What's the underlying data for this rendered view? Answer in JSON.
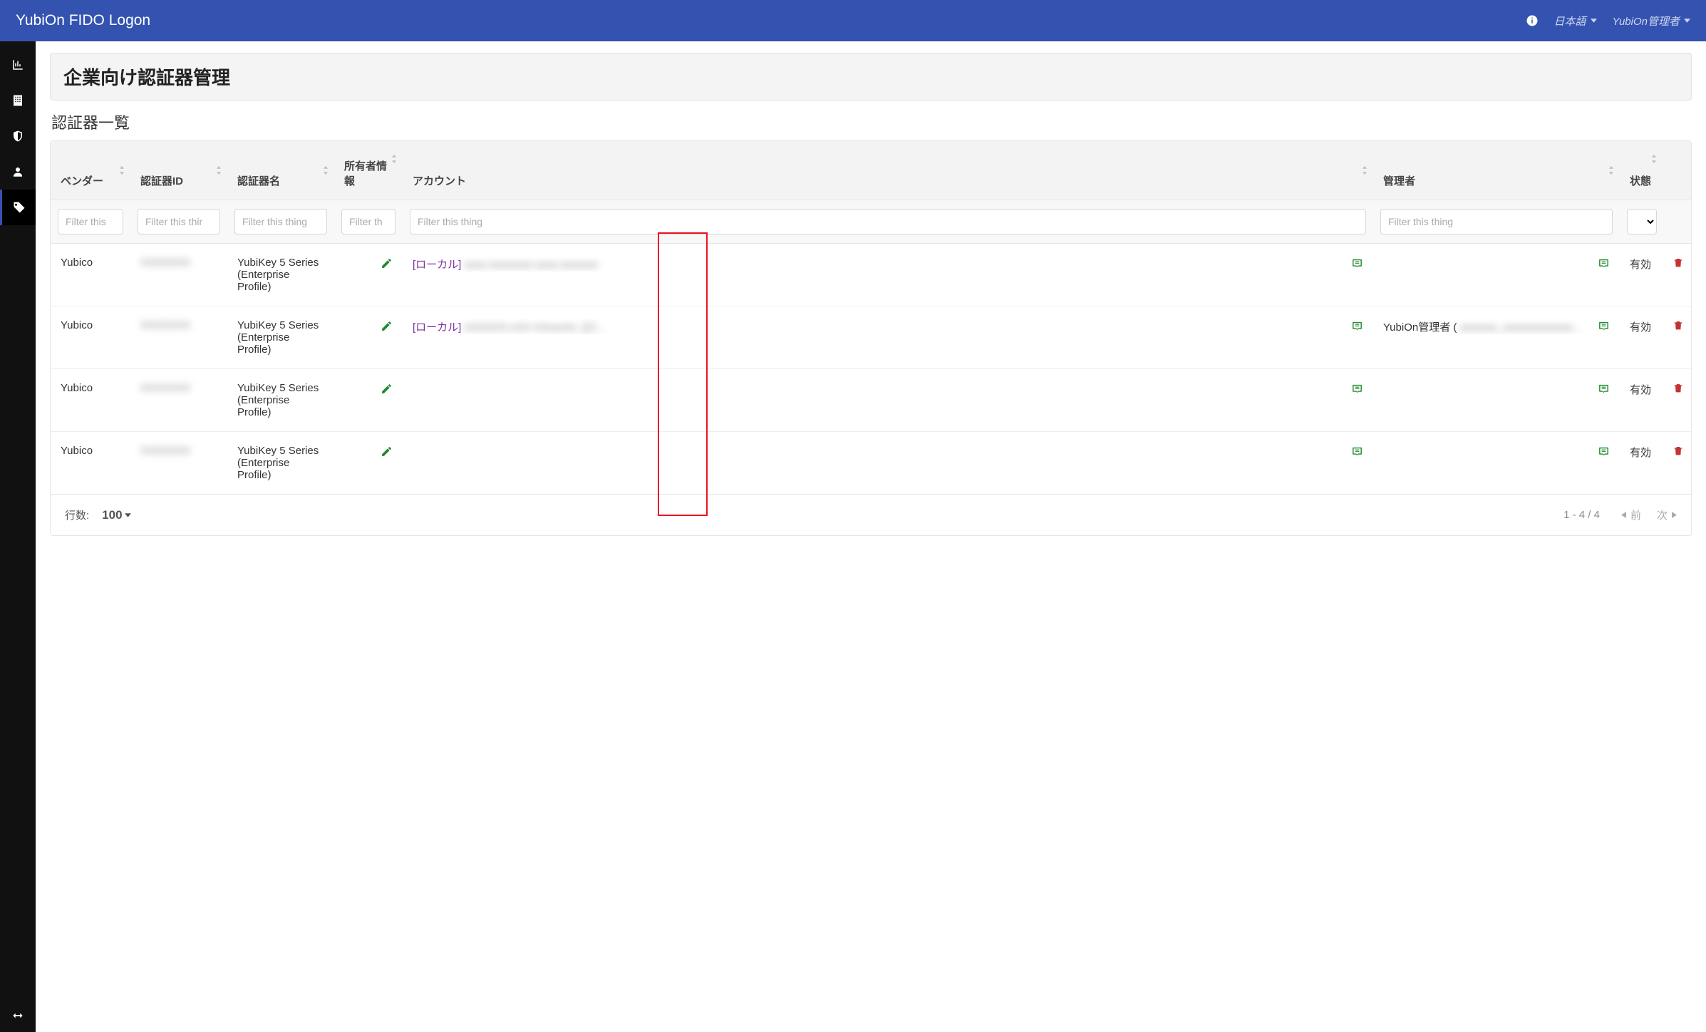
{
  "brand": "YubiOn FIDO Logon",
  "topbar": {
    "language": "日本語",
    "user": "YubiOn管理者"
  },
  "page": {
    "title": "企業向け認証器管理",
    "list_title": "認証器一覧"
  },
  "table": {
    "headers": {
      "vendor": "ベンダー",
      "authenticator_id": "認証器ID",
      "authenticator_name": "認証器名",
      "owner_info": "所有者情報",
      "account": "アカウント",
      "admin": "管理者",
      "status": "状態"
    },
    "filters": {
      "placeholder_short": "Filter this",
      "placeholder_thir": "Filter this thir",
      "placeholder_thing": "Filter this thing",
      "placeholder_th": "Filter th"
    },
    "rows": [
      {
        "vendor": "Yubico",
        "authenticator_id": "XXXXXXX",
        "authenticator_name": "YubiKey 5 Series (Enterprise Profile)",
        "account_prefix": "[ローカル]",
        "account_rest": "xxxx-xxxxxxxx-xxxx-xxxxxxx",
        "admin": "",
        "status": "有効"
      },
      {
        "vendor": "Yubico",
        "authenticator_id": "XXXXXXX",
        "authenticator_name": "YubiKey 5 Series (Enterprise Profile)",
        "account_prefix": "[ローカル]",
        "account_rest": "XXXXXX-xXX-XXxxxXx ,[ロ…",
        "admin": "YubiOn管理者 (",
        "admin_blur": "xxxxxxx_xxxxxxxxxxxxx…",
        "status": "有効"
      },
      {
        "vendor": "Yubico",
        "authenticator_id": "XXXXXXX",
        "authenticator_name": "YubiKey 5 Series (Enterprise Profile)",
        "account_prefix": "",
        "account_rest": "",
        "admin": "",
        "status": "有効"
      },
      {
        "vendor": "Yubico",
        "authenticator_id": "XXXXXXX",
        "authenticator_name": "YubiKey 5 Series (Enterprise Profile)",
        "account_prefix": "",
        "account_rest": "",
        "admin": "",
        "status": "有効"
      }
    ]
  },
  "footer": {
    "rows_label": "行数:",
    "rows_value": "100",
    "range": "1 - 4 / 4",
    "prev": "前",
    "next": "次"
  },
  "icons": {
    "info": "info-icon",
    "chart": "chart-icon",
    "building": "building-icon",
    "shield": "shield-icon",
    "user": "user-icon",
    "tag": "tag-icon",
    "expand": "expand-icon",
    "edit": "edit-icon",
    "inbox": "inbox-icon",
    "trash": "trash-icon"
  }
}
